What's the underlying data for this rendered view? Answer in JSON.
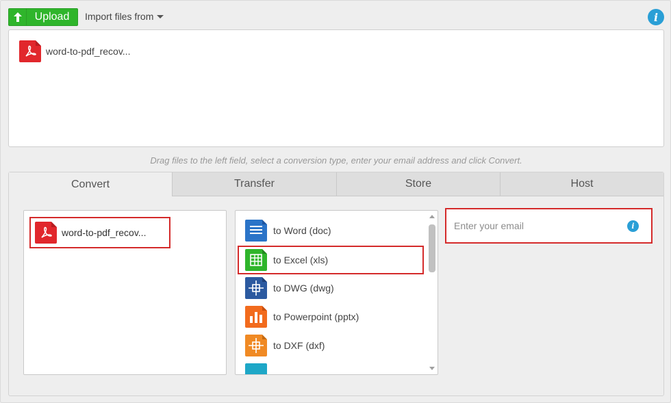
{
  "toolbar": {
    "upload_label": "Upload",
    "import_label": "Import files from"
  },
  "dropzone": {
    "files": [
      {
        "name": "word-to-pdf_recov...",
        "type": "pdf"
      }
    ]
  },
  "hint": "Drag files to the left field, select a conversion type, enter your email address and click Convert.",
  "tabs": [
    {
      "label": "Convert",
      "active": true
    },
    {
      "label": "Transfer",
      "active": false
    },
    {
      "label": "Store",
      "active": false
    },
    {
      "label": "Host",
      "active": false
    }
  ],
  "selected_file": {
    "name": "word-to-pdf_recov..."
  },
  "conversions": [
    {
      "label": "to Word (doc)",
      "icon": "word-icon",
      "selected": false
    },
    {
      "label": "to Excel (xls)",
      "icon": "excel-icon",
      "selected": true
    },
    {
      "label": "to DWG (dwg)",
      "icon": "dwg-icon",
      "selected": false
    },
    {
      "label": "to Powerpoint (pptx)",
      "icon": "powerpoint-icon",
      "selected": false
    },
    {
      "label": "to DXF (dxf)",
      "icon": "dxf-icon",
      "selected": false
    }
  ],
  "email": {
    "placeholder": "Enter your email",
    "value": ""
  },
  "colors": {
    "accent_green": "#2fb52b",
    "pdf_red": "#e1272c",
    "highlight_red": "#d42a2a",
    "info_blue": "#2a9fd6"
  }
}
